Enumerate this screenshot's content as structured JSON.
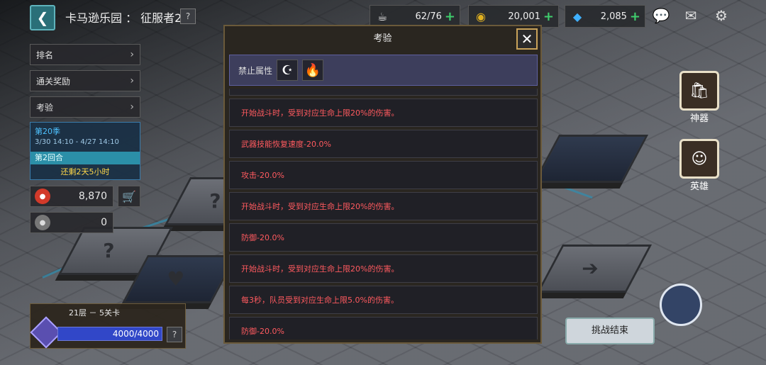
{
  "header": {
    "title": "卡马逊乐园 ： 征服者2",
    "help_label": "?"
  },
  "resources": [
    {
      "icon": "coffee-icon",
      "value": "62/76"
    },
    {
      "icon": "gold-coin-icon",
      "value": "20,001"
    },
    {
      "icon": "gem-icon",
      "value": "2,085"
    }
  ],
  "sidebar": {
    "items": [
      {
        "label": "排名"
      },
      {
        "label": "通关奖励"
      },
      {
        "label": "考验"
      }
    ],
    "season": {
      "name": "第20季",
      "period": "3/30 14:10 - 4/27 14:10",
      "round": "第2回合",
      "time_left": "还剩2天5小时"
    },
    "currencies": [
      {
        "icon": "red-token-icon",
        "value": "8,870"
      },
      {
        "icon": "gray-token-icon",
        "value": "0"
      }
    ]
  },
  "floor": {
    "label": "21层 － 5关卡",
    "progress_text": "4000/4000",
    "progress": 1.0,
    "help_label": "?"
  },
  "modal": {
    "title": "考验",
    "forbidden_label": "禁止属性",
    "forbidden_elements": [
      "moon-icon",
      "fire-icon"
    ],
    "debuffs": [
      "开始战斗时，受到对应生命上限20%的伤害。",
      "武器技能恢复速度-20.0%",
      "攻击-20.0%",
      "开始战斗时，受到对应生命上限20%的伤害。",
      "防御-20.0%",
      "开始战斗时，受到对应生命上限20%的伤害。",
      "每3秒，队员受到对应生命上限5.0%的伤害。",
      "防御-20.0%"
    ]
  },
  "side_buttons": [
    {
      "label": "神器",
      "icon": "shopping-bag-icon"
    },
    {
      "label": "英雄",
      "icon": "hero-face-icon"
    }
  ],
  "end_button": {
    "label": "挑战结束"
  },
  "colors": {
    "debuff_text": "#ff5a5f",
    "season_accent": "#4fc2ff",
    "time_left": "#ffd84a",
    "plus": "#3fce6d"
  }
}
